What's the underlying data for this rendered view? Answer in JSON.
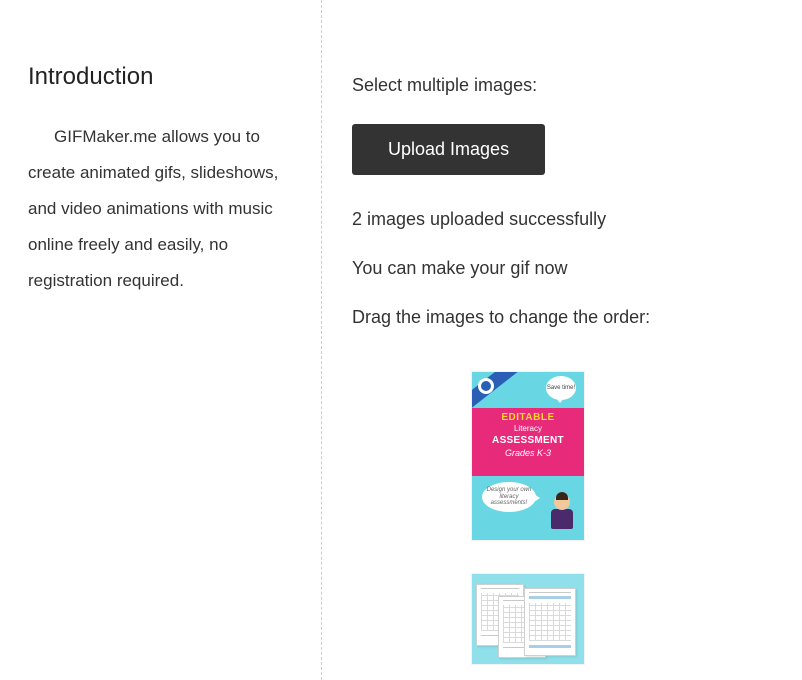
{
  "intro": {
    "heading": "Introduction",
    "paragraph": "GIFMaker.me allows you to create animated gifs, slideshows, and video animations with music online freely and easily, no registration required."
  },
  "upload": {
    "select_label": "Select multiple images:",
    "button_label": "Upload Images",
    "status_uploaded": "2 images uploaded successfully",
    "status_ready": "You can make your gif now",
    "drag_label": "Drag the images to change the order:"
  },
  "thumbnails": [
    {
      "id": "thumb-1",
      "lines": {
        "save": "Save time!",
        "l1": "EDITABLE",
        "l2": "Literacy",
        "l3": "ASSESSMENT",
        "l4": "Grades K-3",
        "design": "Design your own literacy assessments!"
      }
    },
    {
      "id": "thumb-2"
    }
  ]
}
